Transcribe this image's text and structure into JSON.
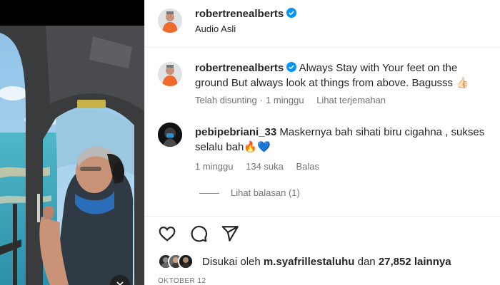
{
  "post": {
    "author": "robertrenealberts",
    "audio": "Audio Asli",
    "caption_text": "Always Stay with Your feet on the ground But always look at things from above. Bagusss",
    "caption_emoji": "👍🏻",
    "edited_label": "Telah disunting",
    "caption_age": "1 minggu",
    "see_translation": "Lihat terjemahan"
  },
  "comment": {
    "user": "pebipebriani_33",
    "text": "Maskernya bah sihati biru cigahna , sukses selalu bah",
    "emoji": "🔥💙",
    "age": "1 minggu",
    "likes": "134 suka",
    "reply": "Balas",
    "view_replies": "Lihat balasan (1)"
  },
  "likes": {
    "prefix": "Disukai oleh",
    "user": "m.syafrillestaluhu",
    "mid": "dan",
    "count": "27,852 lainnya"
  },
  "date": "OKTOBER 12",
  "icons": {
    "verified": "verified-badge-icon",
    "like": "heart-icon",
    "comment": "comment-bubble-icon",
    "share": "paper-plane-icon",
    "media_action": "video-control-icon"
  },
  "colors": {
    "verified_blue": "#0095f6",
    "secondary_text": "#737373",
    "primary_text": "#262626",
    "divider": "#efefef"
  }
}
